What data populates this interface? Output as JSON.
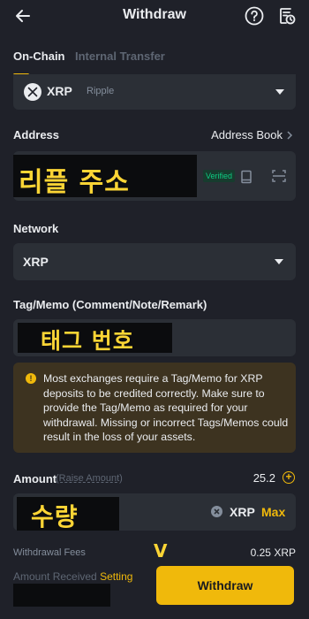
{
  "header": {
    "title": "Withdraw",
    "back_icon": "arrow-left-icon",
    "help_icon": "question-circle-icon",
    "history_icon": "history-icon"
  },
  "tabs": [
    {
      "label": "On-Chain",
      "active": true
    },
    {
      "label": "Internal Transfer",
      "active": false
    }
  ],
  "coin": {
    "symbol": "XRP",
    "name": "Ripple"
  },
  "address": {
    "label": "Address",
    "book_label": "Address Book",
    "overlay_text": "리플 주소",
    "verified_badge": "Verified"
  },
  "network": {
    "label": "Network",
    "selected": "XRP"
  },
  "tag": {
    "label": "Tag/Memo (Comment/Note/Remark)",
    "overlay_text": "태그 번호"
  },
  "warning": {
    "text": "Most exchanges require a Tag/Memo for XRP deposits to be credited correctly. Make sure to provide the Tag/Memo as required for your withdrawal. Missing or incorrect Tags/Memos could result in the loss of your assets."
  },
  "amount": {
    "label": "Amount",
    "hint": "(Raise Amount)",
    "available": "25.2",
    "overlay_text": "수량",
    "unit": "XRP",
    "max_label": "Max"
  },
  "fees": {
    "label": "Withdrawal Fees",
    "value": "0.25 XRP"
  },
  "received": {
    "label": "Amount Received",
    "setting_label": "Setting"
  },
  "annotation": {
    "mark": "V"
  },
  "withdraw_button": {
    "label": "Withdraw"
  },
  "colors": {
    "accent": "#f0b90b",
    "background": "#1f2129",
    "field": "#2b2f36",
    "verified": "#0ecb81",
    "warning_bg": "#3d3320"
  }
}
